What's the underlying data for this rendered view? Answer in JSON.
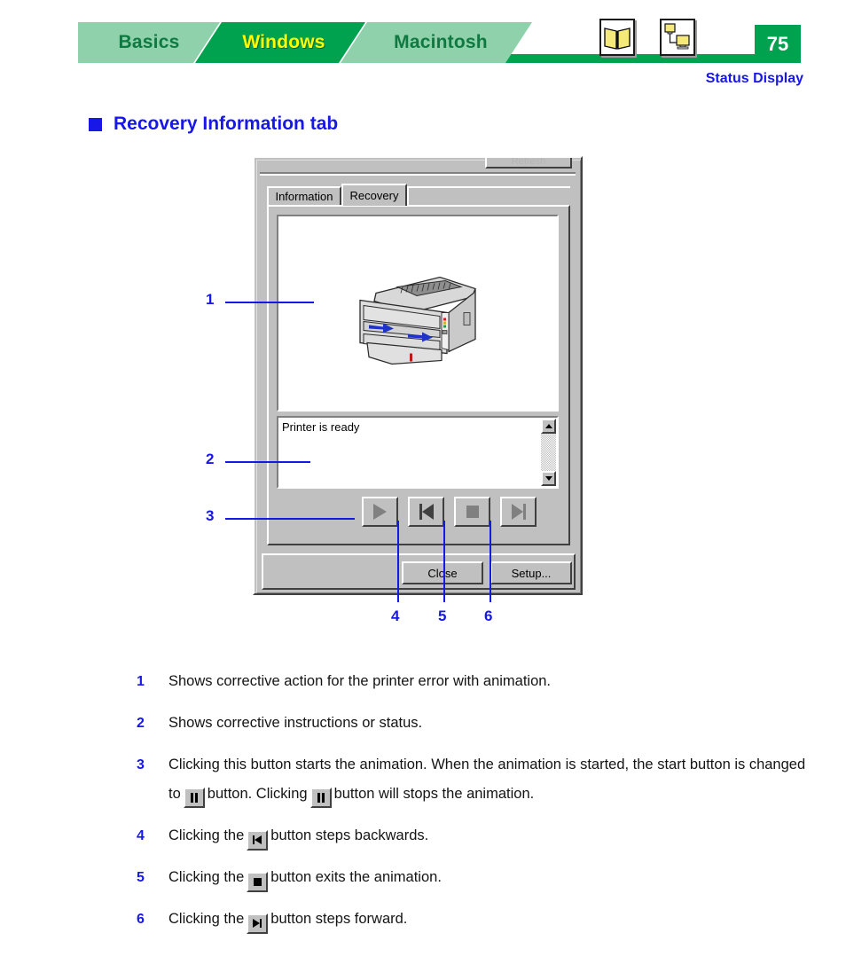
{
  "header": {
    "tabs": [
      {
        "label": "Basics",
        "active": false
      },
      {
        "label": "Windows",
        "active": true
      },
      {
        "label": "Macintosh",
        "active": false
      }
    ],
    "page_number": "75",
    "section_caption": "Status Display",
    "icons": [
      {
        "name": "book-icon",
        "label": "Book"
      },
      {
        "name": "network-icon",
        "label": "Network"
      }
    ],
    "colors": {
      "tab_inactive_bg": "#8fd1ab",
      "tab_inactive_text": "#0e7a42",
      "tab_active_bg": "#00a24f",
      "tab_active_text": "#ffff00",
      "badge_bg": "#00a24f",
      "caption_text": "#1717e8"
    }
  },
  "heading": {
    "text": "Recovery Information tab",
    "color": "#1717e8"
  },
  "dialog": {
    "clipped_button_label": "Refresh",
    "tabs": [
      {
        "label": "Information",
        "selected": false
      },
      {
        "label": "Recovery",
        "selected": true
      }
    ],
    "animation_area": {
      "alt": "printer-illustration"
    },
    "message_box": {
      "value": "Printer is ready",
      "scroll_up": "▲",
      "scroll_down": "▼"
    },
    "playback_buttons": [
      {
        "name": "play-button",
        "glyph": "play"
      },
      {
        "name": "step-backward-button",
        "glyph": "step-back"
      },
      {
        "name": "stop-button",
        "glyph": "stop"
      },
      {
        "name": "step-forward-button",
        "glyph": "step-forward"
      }
    ],
    "footer_buttons": [
      {
        "name": "close-button",
        "label": "Close"
      },
      {
        "name": "setup-button",
        "label": "Setup..."
      }
    ]
  },
  "callouts": [
    {
      "number": "1"
    },
    {
      "number": "2"
    },
    {
      "number": "3"
    },
    {
      "number": "4"
    },
    {
      "number": "5"
    },
    {
      "number": "6"
    }
  ],
  "notes": [
    {
      "number": "1",
      "parts": [
        {
          "type": "text",
          "value": "Shows corrective action for the printer error with animation."
        }
      ]
    },
    {
      "number": "2",
      "parts": [
        {
          "type": "text",
          "value": "Shows corrective instructions or status."
        }
      ]
    },
    {
      "number": "3",
      "parts": [
        {
          "type": "text",
          "value": "Clicking this button starts the animation. When the animation is started, the start button is changed to "
        },
        {
          "type": "icon",
          "value": "pause-icon"
        },
        {
          "type": "text",
          "value": " button. Clicking "
        },
        {
          "type": "icon",
          "value": "pause-icon"
        },
        {
          "type": "text",
          "value": " button will stops the animation."
        }
      ]
    },
    {
      "number": "4",
      "parts": [
        {
          "type": "text",
          "value": "Clicking the "
        },
        {
          "type": "icon",
          "value": "step-backward-icon"
        },
        {
          "type": "text",
          "value": " button steps backwards."
        }
      ]
    },
    {
      "number": "5",
      "parts": [
        {
          "type": "text",
          "value": "Clicking the "
        },
        {
          "type": "icon",
          "value": "stop-icon"
        },
        {
          "type": "text",
          "value": " button exits the animation."
        }
      ]
    },
    {
      "number": "6",
      "parts": [
        {
          "type": "text",
          "value": "Clicking the "
        },
        {
          "type": "icon",
          "value": "step-forward-icon"
        },
        {
          "type": "text",
          "value": " button steps forward."
        }
      ]
    }
  ],
  "notes_text": {
    "n1": "Shows corrective action for the printer error with animation.",
    "n2": "Shows corrective instructions or status.",
    "n3a": "Clicking this button starts the animation. When the animation is started, the start button is changed to",
    "n3b": "button. Clicking",
    "n3c": "button will stops the animation.",
    "n4a": "Clicking the",
    "n4b": "button steps backwards.",
    "n5a": "Clicking the",
    "n5b": "button exits the animation.",
    "n6a": "Clicking the",
    "n6b": "button steps forward."
  }
}
